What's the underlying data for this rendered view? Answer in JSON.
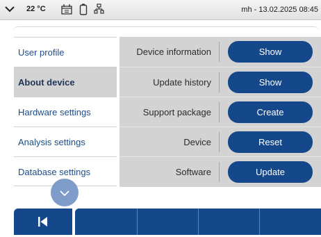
{
  "status_bar": {
    "temperature": "22 °C",
    "datetime": "mh - 13.02.2025 08:45",
    "icons": [
      "chevron-down-icon",
      "calendar-icon",
      "battery-icon",
      "network-icon"
    ]
  },
  "sidebar": {
    "items": [
      {
        "label": "User profile",
        "active": false
      },
      {
        "label": "About device",
        "active": true
      },
      {
        "label": "Hardware settings",
        "active": false
      },
      {
        "label": "Analysis settings",
        "active": false
      },
      {
        "label": "Database settings",
        "active": false
      }
    ]
  },
  "rows": [
    {
      "label": "Device information",
      "button": "Show"
    },
    {
      "label": "Update history",
      "button": "Show"
    },
    {
      "label": "Support package",
      "button": "Create"
    },
    {
      "label": "Device",
      "button": "Reset"
    },
    {
      "label": "Software",
      "button": "Update"
    }
  ],
  "colors": {
    "accent": "#14488a",
    "panel_bg": "#d3d3d3",
    "scroll_button": "#7e9bc9"
  },
  "toolbar": {
    "back_icon": "skip-back-icon"
  }
}
